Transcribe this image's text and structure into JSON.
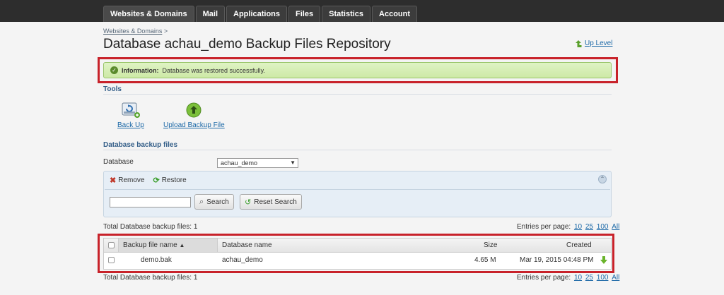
{
  "nav": {
    "tabs": [
      "Websites & Domains",
      "Mail",
      "Applications",
      "Files",
      "Statistics",
      "Account"
    ]
  },
  "breadcrumb": {
    "item": "Websites & Domains",
    "separator": ">"
  },
  "page": {
    "title": "Database achau_demo Backup Files Repository",
    "up_level": "Up Level"
  },
  "message": {
    "label": "Information:",
    "text": "Database was restored successfully."
  },
  "tools": {
    "heading": "Tools",
    "back_up": "Back Up",
    "upload": "Upload Backup File"
  },
  "backups": {
    "heading": "Database backup files",
    "db_label": "Database",
    "db_selected": "achau_demo",
    "remove": "Remove",
    "restore": "Restore",
    "search_value": "",
    "search_btn": "Search",
    "reset_btn": "Reset Search",
    "total_label": "Total Database backup files: 1",
    "entries_label": "Entries per page:",
    "entries_options": [
      "10",
      "25",
      "100",
      "All"
    ]
  },
  "table": {
    "columns": [
      "Backup file name",
      "Database name",
      "Size",
      "Created"
    ],
    "sort_indicator": "▲",
    "rows": [
      {
        "file": "demo.bak",
        "database": "achau_demo",
        "size": "4.65 M",
        "created": "Mar 19, 2015 04:48 PM"
      }
    ]
  },
  "colors": {
    "highlight": "#c8222a",
    "link": "#1e6aa8",
    "success_bg": "#cde9a6"
  }
}
